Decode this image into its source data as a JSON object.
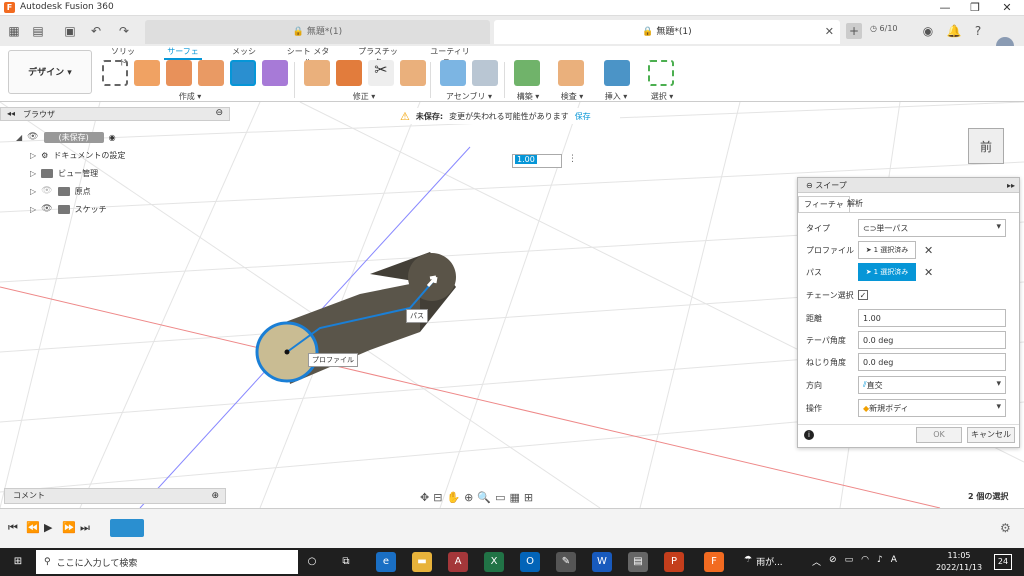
{
  "window": {
    "title": "Autodesk Fusion 360",
    "controls": [
      "—",
      "❐",
      "✕"
    ]
  },
  "tabs": [
    {
      "label": "無題*(1)",
      "lock": "lock-icon",
      "active": false
    },
    {
      "label": "無題*(1)",
      "lock": "lock-icon",
      "active": true
    }
  ],
  "header": {
    "jobs": "6/10"
  },
  "ribbon": {
    "tabs": [
      "ソリッド",
      "サーフェス",
      "メッシュ",
      "シート メタル",
      "プラスチック",
      "ユーティリティ"
    ],
    "workspace": "デザイン",
    "groups": [
      "作成",
      "修正",
      "アセンブリ",
      "構築",
      "検査",
      "挿入",
      "選択"
    ]
  },
  "browser": {
    "title": "ブラウザ",
    "root": "(未保存)",
    "items": [
      "ドキュメントの設定",
      "ビュー管理",
      "原点",
      "スケッチ"
    ]
  },
  "warning": {
    "label": "未保存:",
    "message": "変更が失われる可能性があります",
    "action": "保存"
  },
  "distance_input": "1.00",
  "viewcube": "前",
  "labels": {
    "path": "パス",
    "profile": "プロファイル"
  },
  "sweep": {
    "title": "スイープ",
    "tabs": [
      "フィーチャ",
      "解析"
    ],
    "type": {
      "label": "タイプ",
      "value": "単一パス"
    },
    "profile": {
      "label": "プロファイル",
      "value": "1 選択済み"
    },
    "path": {
      "label": "パス",
      "value": "1 選択済み"
    },
    "chain": {
      "label": "チェーン選択"
    },
    "distance": {
      "label": "距離",
      "value": "1.00"
    },
    "taper": {
      "label": "テーパ角度",
      "value": "0.0 deg"
    },
    "twist": {
      "label": "ねじり角度",
      "value": "0.0 deg"
    },
    "orientation": {
      "label": "方向",
      "value": "直交"
    },
    "operation": {
      "label": "操作",
      "value": "新規ボディ"
    },
    "ok": "OK",
    "cancel": "キャンセル"
  },
  "comment": "コメント",
  "selection_count": "2 個の選択",
  "taskbar": {
    "search": "ここに入力して検索",
    "weather": "雨が...",
    "time": "11:05",
    "date": "2022/11/13",
    "ime": "A",
    "notifications": "24"
  },
  "colors": {
    "accent": "#0696d7",
    "brand": "#f26b21"
  }
}
